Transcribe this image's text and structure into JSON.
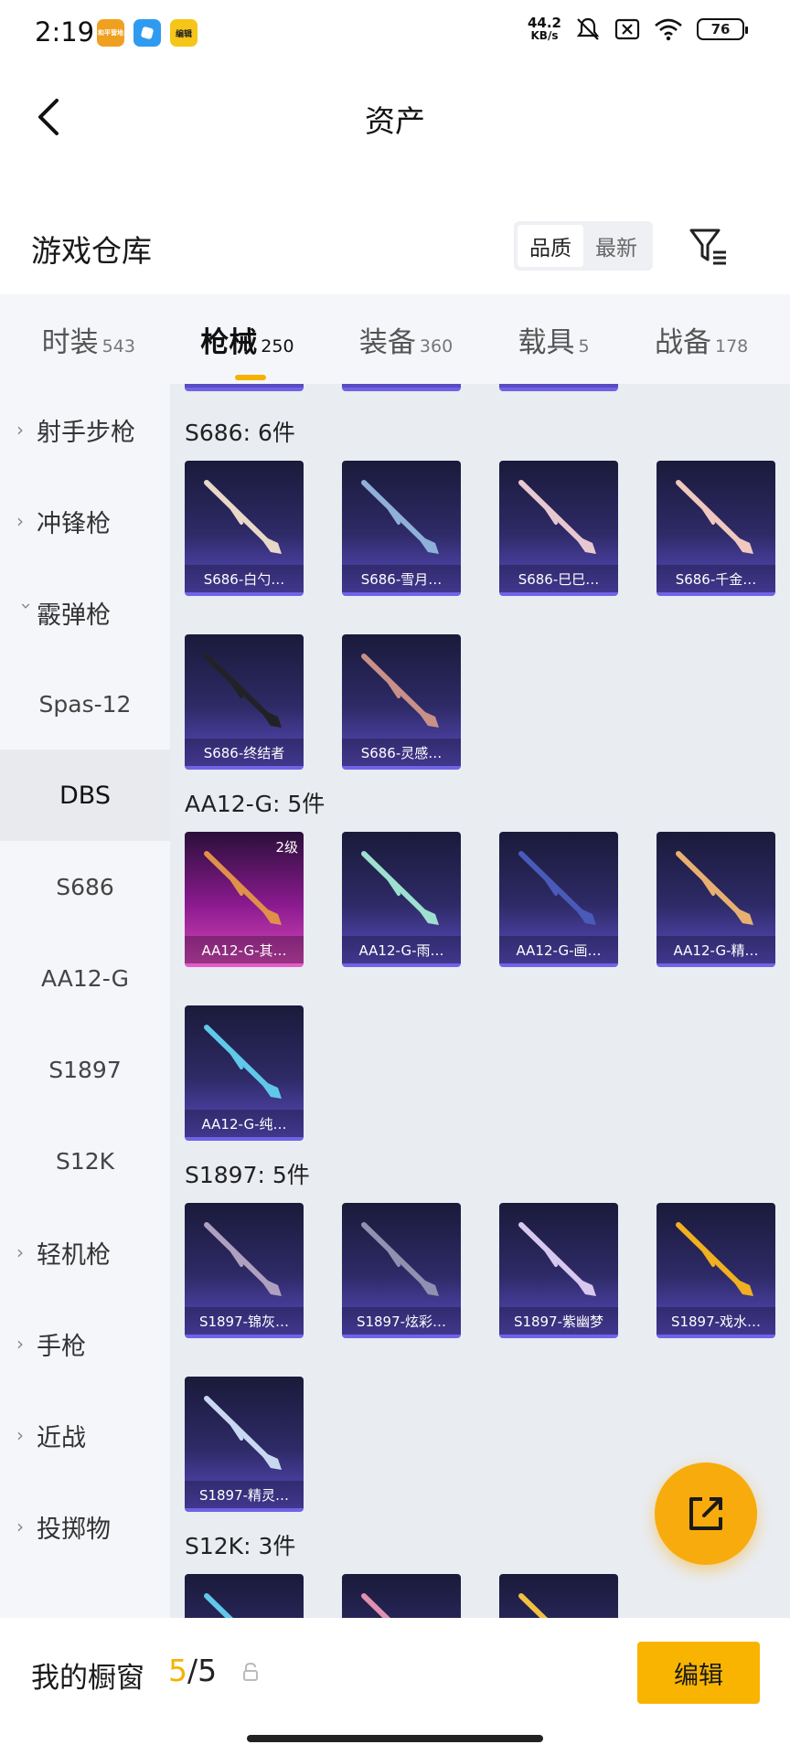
{
  "status_bar": {
    "time": "2:19",
    "app_icons": [
      {
        "name": "game-app-icon",
        "color": "#f0a020",
        "text": "和平营地"
      },
      {
        "name": "blue-app-icon",
        "color": "#2f9bf0",
        "text": ""
      },
      {
        "name": "yellow-app-icon",
        "color": "#f5c518",
        "text": "编辑"
      }
    ],
    "net_speed_value": "44.2",
    "net_speed_unit": "KB/s",
    "battery": "76"
  },
  "header": {
    "title": "资产"
  },
  "warehouse": {
    "title": "游戏仓库",
    "sort_options": [
      "品质",
      "最新"
    ],
    "active_sort": "品质"
  },
  "category_tabs": [
    {
      "label": "时装",
      "count": "543"
    },
    {
      "label": "枪械",
      "count": "250",
      "active": true
    },
    {
      "label": "装备",
      "count": "360"
    },
    {
      "label": "载具",
      "count": "5"
    },
    {
      "label": "战备",
      "count": "178"
    }
  ],
  "sidebar": {
    "items": [
      {
        "label": "射手步枪",
        "type": "parent",
        "expanded": false
      },
      {
        "label": "冲锋枪",
        "type": "parent",
        "expanded": false
      },
      {
        "label": "霰弹枪",
        "type": "parent",
        "expanded": true
      },
      {
        "label": "Spas-12",
        "type": "child"
      },
      {
        "label": "DBS",
        "type": "child",
        "active": true
      },
      {
        "label": "S686",
        "type": "child"
      },
      {
        "label": "AA12-G",
        "type": "child"
      },
      {
        "label": "S1897",
        "type": "child"
      },
      {
        "label": "S12K",
        "type": "child"
      },
      {
        "label": "轻机枪",
        "type": "parent",
        "expanded": false
      },
      {
        "label": "手枪",
        "type": "parent",
        "expanded": false
      },
      {
        "label": "近战",
        "type": "parent",
        "expanded": false
      },
      {
        "label": "投掷物",
        "type": "parent",
        "expanded": false
      }
    ]
  },
  "groups": [
    {
      "title": "S686: 6件",
      "items": [
        {
          "label": "S686-白勺…",
          "weapon_color": "#e8d8c8"
        },
        {
          "label": "S686-雪月…",
          "weapon_color": "#8fb0d8"
        },
        {
          "label": "S686-巳巳…",
          "weapon_color": "#e8c8d0"
        },
        {
          "label": "S686-千金…",
          "weapon_color": "#f0c8c0"
        },
        {
          "label": "S686-终结者",
          "weapon_color": "#222226"
        },
        {
          "label": "S686-灵感…",
          "weapon_color": "#c89088"
        }
      ]
    },
    {
      "title": "AA12-G: 5件",
      "items": [
        {
          "label": "AA12-G-其…",
          "weapon_color": "#e09048",
          "level": "2级",
          "rarity": "pink"
        },
        {
          "label": "AA12-G-雨…",
          "weapon_color": "#9de0d0"
        },
        {
          "label": "AA12-G-画…",
          "weapon_color": "#4a5ab8"
        },
        {
          "label": "AA12-G-精…",
          "weapon_color": "#e8b070"
        },
        {
          "label": "AA12-G-纯…",
          "weapon_color": "#60c8e8"
        }
      ]
    },
    {
      "title": "S1897: 5件",
      "items": [
        {
          "label": "S1897-锦灰…",
          "weapon_color": "#b0a0c0"
        },
        {
          "label": "S1897-炫彩…",
          "weapon_color": "#9090b0"
        },
        {
          "label": "S1897-紫幽梦",
          "weapon_color": "#d8c8f0"
        },
        {
          "label": "S1897-戏水…",
          "weapon_color": "#f0b020"
        },
        {
          "label": "S1897-精灵…",
          "weapon_color": "#c8d8f0"
        }
      ]
    },
    {
      "title": "S12K: 3件",
      "items": [
        {
          "label": "",
          "weapon_color": "#60c8e8"
        },
        {
          "label": "",
          "weapon_color": "#e090b0"
        },
        {
          "label": "",
          "weapon_color": "#f0c040"
        }
      ]
    }
  ],
  "showcase": {
    "label": "我的橱窗",
    "current": "5",
    "separator": "/",
    "total": "5"
  },
  "edit_button": "编辑",
  "colors": {
    "accent": "#f5b300",
    "card_gradient_bottom": "#5b4cc4",
    "card_pink_bottom": "#d447b8"
  }
}
